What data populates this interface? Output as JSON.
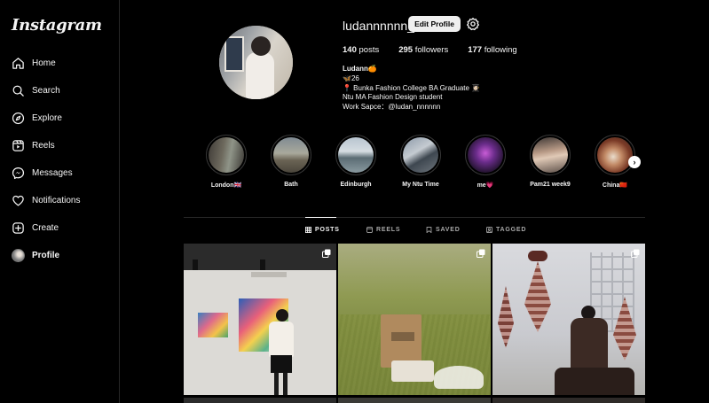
{
  "app": {
    "logo": "Instagram"
  },
  "sidebar": {
    "items": [
      {
        "label": "Home",
        "icon": "home-icon"
      },
      {
        "label": "Search",
        "icon": "search-icon"
      },
      {
        "label": "Explore",
        "icon": "compass-icon"
      },
      {
        "label": "Reels",
        "icon": "reels-icon"
      },
      {
        "label": "Messages",
        "icon": "messenger-icon"
      },
      {
        "label": "Notifications",
        "icon": "heart-icon"
      },
      {
        "label": "Create",
        "icon": "plus-square-icon"
      },
      {
        "label": "Profile",
        "icon": "avatar"
      }
    ]
  },
  "profile": {
    "username": "ludannnnnn_",
    "edit_label": "Edit Profile",
    "posts_count": "140",
    "posts_label": " posts",
    "followers_count": "295",
    "followers_label": " followers",
    "following_count": "177",
    "following_label": " following",
    "bio": {
      "name": "Ludann🍊",
      "line1": "🦋26",
      "line2": "📍 Bunka Fashion College BA Graduate 👩🏻‍🎓",
      "line3": "Ntu MA Fashion Design student",
      "line4": "Work Sapce：@ludan_nnnnnn"
    }
  },
  "highlights": [
    {
      "label": "London🇬🇧"
    },
    {
      "label": "Bath"
    },
    {
      "label": "Edinburgh"
    },
    {
      "label": "My Ntu Time"
    },
    {
      "label": "me💗"
    },
    {
      "label": "Pam21 week9"
    },
    {
      "label": "China🇨🇳"
    }
  ],
  "tabs": [
    {
      "label": "POSTS",
      "active": true
    },
    {
      "label": "REELS",
      "active": false
    },
    {
      "label": "SAVED",
      "active": false
    },
    {
      "label": "TAGGED",
      "active": false
    }
  ],
  "colors": {
    "background": "#000000",
    "border": "#262626",
    "text": "#f5f5f5",
    "muted": "#a8a8a8",
    "button": "#efefef"
  }
}
